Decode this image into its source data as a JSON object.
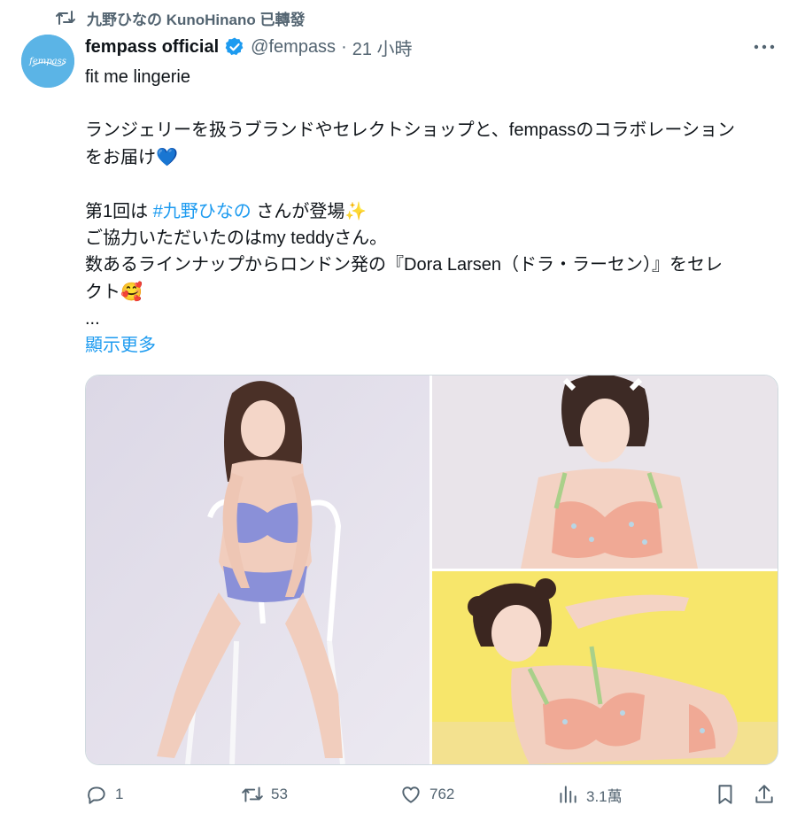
{
  "retweet": {
    "text": "九野ひなの KunoHinano 已轉發"
  },
  "author": {
    "display_name": "fempass official",
    "handle": "@fempass",
    "separator": "·",
    "time": "21 小時",
    "avatar_text": "fempass"
  },
  "tweet": {
    "line1": "fit me lingerie",
    "line2": "ランジェリーを扱うブランドやセレクトショップと、fempassのコラボレーション",
    "line3": "をお届け",
    "line3_emoji": "💙",
    "line4_pre": "第1回は ",
    "line4_hashtag": "#九野ひなの",
    "line4_post": " さんが登場",
    "line4_emoji": "✨",
    "line5": "ご協力いただいたのはmy teddyさん。",
    "line6": "数あるラインナップからロンドン発の『Dora Larsen（ドラ・ラーセン）』をセレ",
    "line7": "クト",
    "line7_emoji": "🥰",
    "ellipsis": "...",
    "show_more": "顯示更多"
  },
  "actions": {
    "replies": "1",
    "retweets": "53",
    "likes": "762",
    "views": "3.1萬"
  },
  "icons": {
    "retweet_indicator": "retweet-icon",
    "verified": "verified-badge-icon",
    "more": "more-options-icon",
    "reply": "reply-icon",
    "retweet": "retweet-icon",
    "like": "heart-icon",
    "views": "views-chart-icon",
    "bookmark": "bookmark-icon",
    "share": "share-icon"
  },
  "colors": {
    "link": "#1d9bf0",
    "secondary_text": "#536471",
    "verified": "#1d9bf0",
    "avatar_bg": "#5bb4e6"
  }
}
